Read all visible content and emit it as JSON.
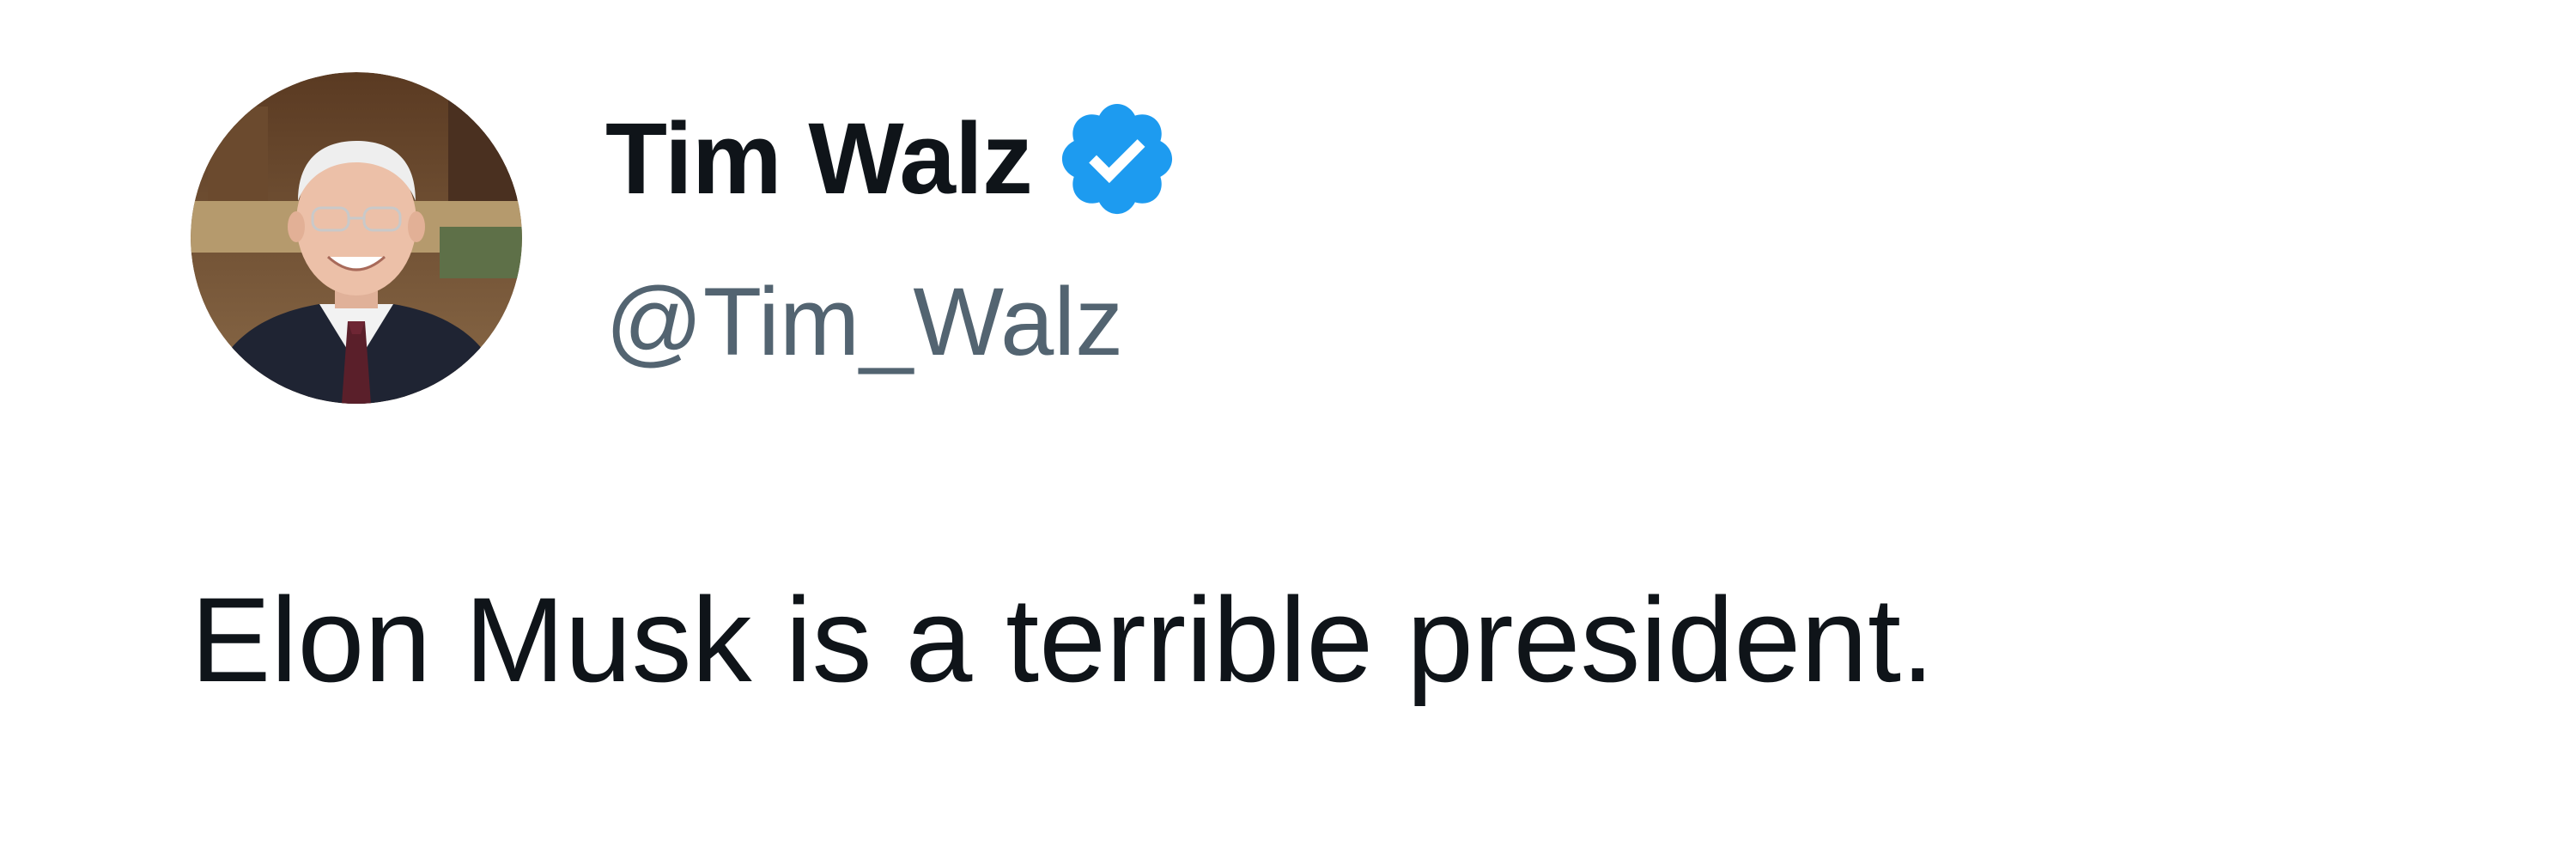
{
  "tweet": {
    "author": {
      "display_name": "Tim Walz",
      "handle": "@Tim_Walz",
      "verified": true,
      "avatar_icon": "profile-photo"
    },
    "text": "Elon Musk is a terrible president."
  },
  "colors": {
    "background": "#ffffff",
    "text_primary": "#0f1419",
    "text_secondary": "#536471",
    "verified_badge": "#1d9bf0"
  }
}
